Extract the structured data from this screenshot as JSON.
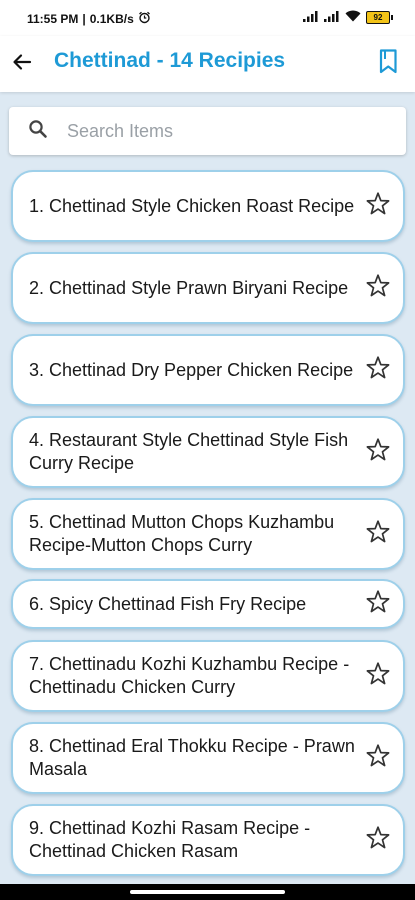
{
  "status_bar": {
    "time": "11:55 PM",
    "net_speed": "0.1KB/s",
    "separator": "|",
    "battery_level": "92"
  },
  "app_bar": {
    "title": "Chettinad - 14 Recipies",
    "back_icon": "arrow-left-icon",
    "bookmark_icon": "bookmark-icon"
  },
  "search": {
    "placeholder": "Search Items",
    "value": ""
  },
  "colors": {
    "accent": "#1e9ad6",
    "background": "#dde9f3",
    "card_border": "#9ed0ea"
  },
  "recipes": [
    {
      "title": "1. Chettinad Style Chicken Roast Recipe",
      "favorite": false
    },
    {
      "title": "2. Chettinad Style Prawn Biryani Recipe",
      "favorite": false
    },
    {
      "title": "3. Chettinad Dry Pepper Chicken Recipe",
      "favorite": false
    },
    {
      "title": "4. Restaurant Style Chettinad Style Fish Curry Recipe",
      "favorite": false
    },
    {
      "title": "5. Chettinad Mutton Chops Kuzhambu Recipe-Mutton Chops Curry",
      "favorite": false
    },
    {
      "title": "6. Spicy Chettinad Fish Fry Recipe",
      "favorite": false
    },
    {
      "title": "7. Chettinadu Kozhi Kuzhambu Recipe - Chettinadu Chicken Curry",
      "favorite": false
    },
    {
      "title": "8. Chettinad Eral Thokku Recipe - Prawn Masala",
      "favorite": false
    },
    {
      "title": "9. Chettinad Kozhi Rasam Recipe - Chettinad Chicken Rasam",
      "favorite": false
    }
  ]
}
